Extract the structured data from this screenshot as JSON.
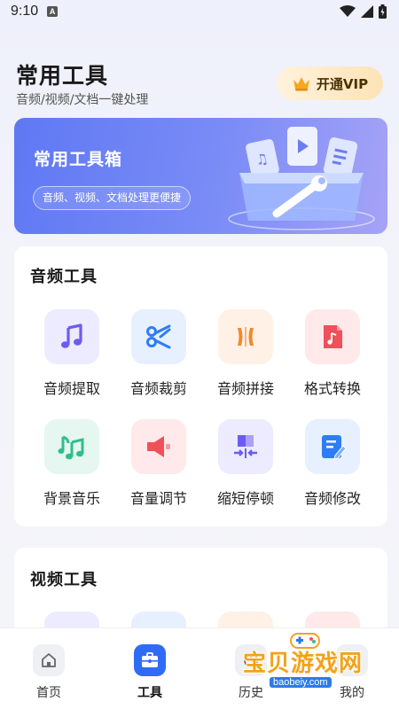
{
  "status_bar": {
    "time": "9:10",
    "notification_icon": "A"
  },
  "header": {
    "title": "常用工具",
    "subtitle": "音频/视频/文档一键处理",
    "vip_label": "开通VIP"
  },
  "banner": {
    "title": "常用工具箱",
    "subtitle": "音频、视频、文档处理更便捷"
  },
  "audio_section": {
    "title": "音频工具",
    "tools": [
      {
        "label": "音频提取",
        "icon": "music-note-icon",
        "bg": "#ecebff",
        "fg": "#6c5cf0"
      },
      {
        "label": "音频裁剪",
        "icon": "scissors-icon",
        "bg": "#e7f0ff",
        "fg": "#2f7df6"
      },
      {
        "label": "音频拼接",
        "icon": "merge-icon",
        "bg": "#fff1e6",
        "fg": "#f08a2c"
      },
      {
        "label": "格式转换",
        "icon": "audio-file-icon",
        "bg": "#ffe9ea",
        "fg": "#f0505a"
      },
      {
        "label": "背景音乐",
        "icon": "music-notes-icon",
        "bg": "#e5f7f0",
        "fg": "#2fbf8a"
      },
      {
        "label": "音量调节",
        "icon": "speaker-icon",
        "bg": "#ffe9ea",
        "fg": "#f0505a"
      },
      {
        "label": "缩短停顿",
        "icon": "shorten-icon",
        "bg": "#ecebff",
        "fg": "#6c5cf0"
      },
      {
        "label": "音频修改",
        "icon": "edit-doc-icon",
        "bg": "#e7f0ff",
        "fg": "#2f7df6"
      }
    ]
  },
  "video_section": {
    "title": "视频工具"
  },
  "bottom_nav": {
    "items": [
      {
        "label": "首页",
        "icon": "home-icon"
      },
      {
        "label": "工具",
        "icon": "toolbox-icon"
      },
      {
        "label": "历史",
        "icon": "history-icon"
      },
      {
        "label": "我的",
        "icon": "profile-icon"
      }
    ],
    "active_index": 1
  },
  "watermark": {
    "text": "宝贝游戏网",
    "url": "baobeiy.com"
  },
  "colors": {
    "accent": "#2f6cf6",
    "banner_start": "#5f78f3",
    "banner_end": "#a6a3f6",
    "vip_text": "#4a3000"
  }
}
